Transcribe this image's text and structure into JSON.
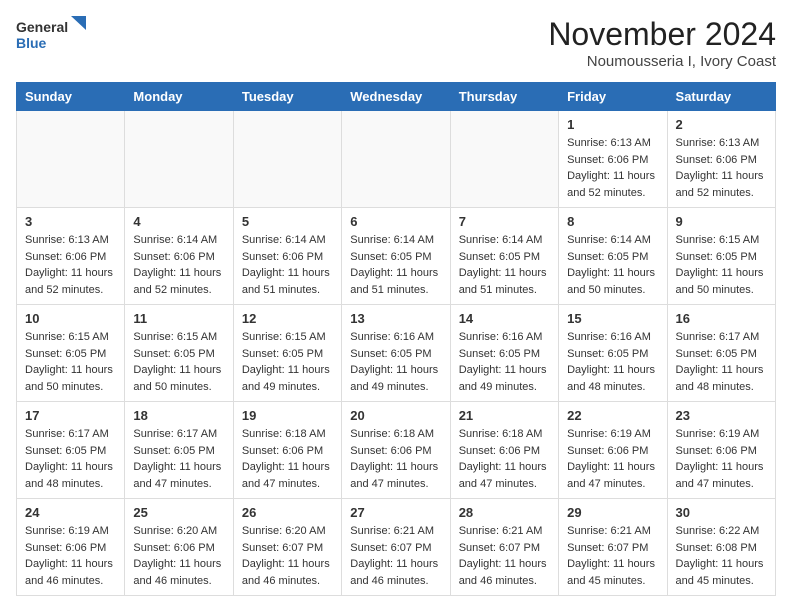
{
  "header": {
    "logo_general": "General",
    "logo_blue": "Blue",
    "title": "November 2024",
    "subtitle": "Noumousseria I, Ivory Coast"
  },
  "weekdays": [
    "Sunday",
    "Monday",
    "Tuesday",
    "Wednesday",
    "Thursday",
    "Friday",
    "Saturday"
  ],
  "weeks": [
    [
      {
        "day": "",
        "info": ""
      },
      {
        "day": "",
        "info": ""
      },
      {
        "day": "",
        "info": ""
      },
      {
        "day": "",
        "info": ""
      },
      {
        "day": "",
        "info": ""
      },
      {
        "day": "1",
        "info": "Sunrise: 6:13 AM\nSunset: 6:06 PM\nDaylight: 11 hours\nand 52 minutes."
      },
      {
        "day": "2",
        "info": "Sunrise: 6:13 AM\nSunset: 6:06 PM\nDaylight: 11 hours\nand 52 minutes."
      }
    ],
    [
      {
        "day": "3",
        "info": "Sunrise: 6:13 AM\nSunset: 6:06 PM\nDaylight: 11 hours\nand 52 minutes."
      },
      {
        "day": "4",
        "info": "Sunrise: 6:14 AM\nSunset: 6:06 PM\nDaylight: 11 hours\nand 52 minutes."
      },
      {
        "day": "5",
        "info": "Sunrise: 6:14 AM\nSunset: 6:06 PM\nDaylight: 11 hours\nand 51 minutes."
      },
      {
        "day": "6",
        "info": "Sunrise: 6:14 AM\nSunset: 6:05 PM\nDaylight: 11 hours\nand 51 minutes."
      },
      {
        "day": "7",
        "info": "Sunrise: 6:14 AM\nSunset: 6:05 PM\nDaylight: 11 hours\nand 51 minutes."
      },
      {
        "day": "8",
        "info": "Sunrise: 6:14 AM\nSunset: 6:05 PM\nDaylight: 11 hours\nand 50 minutes."
      },
      {
        "day": "9",
        "info": "Sunrise: 6:15 AM\nSunset: 6:05 PM\nDaylight: 11 hours\nand 50 minutes."
      }
    ],
    [
      {
        "day": "10",
        "info": "Sunrise: 6:15 AM\nSunset: 6:05 PM\nDaylight: 11 hours\nand 50 minutes."
      },
      {
        "day": "11",
        "info": "Sunrise: 6:15 AM\nSunset: 6:05 PM\nDaylight: 11 hours\nand 50 minutes."
      },
      {
        "day": "12",
        "info": "Sunrise: 6:15 AM\nSunset: 6:05 PM\nDaylight: 11 hours\nand 49 minutes."
      },
      {
        "day": "13",
        "info": "Sunrise: 6:16 AM\nSunset: 6:05 PM\nDaylight: 11 hours\nand 49 minutes."
      },
      {
        "day": "14",
        "info": "Sunrise: 6:16 AM\nSunset: 6:05 PM\nDaylight: 11 hours\nand 49 minutes."
      },
      {
        "day": "15",
        "info": "Sunrise: 6:16 AM\nSunset: 6:05 PM\nDaylight: 11 hours\nand 48 minutes."
      },
      {
        "day": "16",
        "info": "Sunrise: 6:17 AM\nSunset: 6:05 PM\nDaylight: 11 hours\nand 48 minutes."
      }
    ],
    [
      {
        "day": "17",
        "info": "Sunrise: 6:17 AM\nSunset: 6:05 PM\nDaylight: 11 hours\nand 48 minutes."
      },
      {
        "day": "18",
        "info": "Sunrise: 6:17 AM\nSunset: 6:05 PM\nDaylight: 11 hours\nand 47 minutes."
      },
      {
        "day": "19",
        "info": "Sunrise: 6:18 AM\nSunset: 6:06 PM\nDaylight: 11 hours\nand 47 minutes."
      },
      {
        "day": "20",
        "info": "Sunrise: 6:18 AM\nSunset: 6:06 PM\nDaylight: 11 hours\nand 47 minutes."
      },
      {
        "day": "21",
        "info": "Sunrise: 6:18 AM\nSunset: 6:06 PM\nDaylight: 11 hours\nand 47 minutes."
      },
      {
        "day": "22",
        "info": "Sunrise: 6:19 AM\nSunset: 6:06 PM\nDaylight: 11 hours\nand 47 minutes."
      },
      {
        "day": "23",
        "info": "Sunrise: 6:19 AM\nSunset: 6:06 PM\nDaylight: 11 hours\nand 47 minutes."
      }
    ],
    [
      {
        "day": "24",
        "info": "Sunrise: 6:19 AM\nSunset: 6:06 PM\nDaylight: 11 hours\nand 46 minutes."
      },
      {
        "day": "25",
        "info": "Sunrise: 6:20 AM\nSunset: 6:06 PM\nDaylight: 11 hours\nand 46 minutes."
      },
      {
        "day": "26",
        "info": "Sunrise: 6:20 AM\nSunset: 6:07 PM\nDaylight: 11 hours\nand 46 minutes."
      },
      {
        "day": "27",
        "info": "Sunrise: 6:21 AM\nSunset: 6:07 PM\nDaylight: 11 hours\nand 46 minutes."
      },
      {
        "day": "28",
        "info": "Sunrise: 6:21 AM\nSunset: 6:07 PM\nDaylight: 11 hours\nand 46 minutes."
      },
      {
        "day": "29",
        "info": "Sunrise: 6:21 AM\nSunset: 6:07 PM\nDaylight: 11 hours\nand 45 minutes."
      },
      {
        "day": "30",
        "info": "Sunrise: 6:22 AM\nSunset: 6:08 PM\nDaylight: 11 hours\nand 45 minutes."
      }
    ]
  ]
}
